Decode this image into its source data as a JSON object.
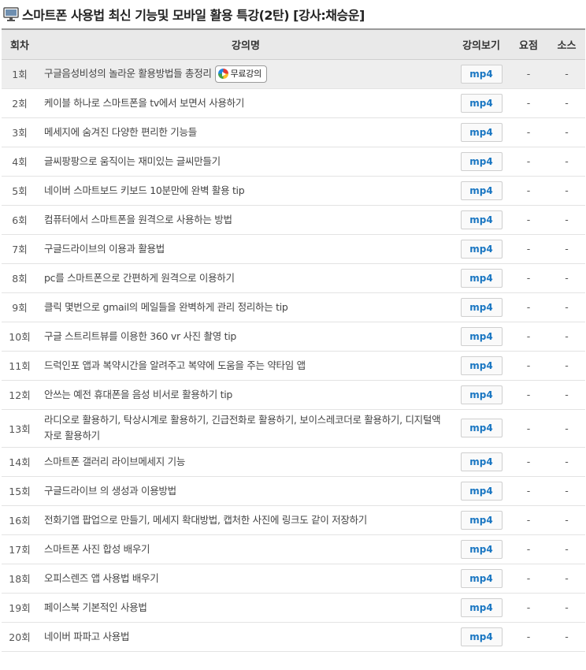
{
  "page": {
    "title": "스마트폰 사용법 최신 기능및 모바일 활용 특강(2탄) [강사:채승운]"
  },
  "table": {
    "headers": {
      "no": "회차",
      "subject": "강의명",
      "view": "강의보기",
      "summary": "요점",
      "source": "소스"
    },
    "free_badge": "무료강의",
    "rows": [
      {
        "no": "1회",
        "subject": "구글음성비성의 놀라운 활용방법들 총정리",
        "view": "mp4",
        "summary": "-",
        "source": "-"
      },
      {
        "no": "2회",
        "subject": "케이블 하나로 스마트폰을 tv에서 보면서 사용하기",
        "view": "mp4",
        "summary": "-",
        "source": "-"
      },
      {
        "no": "3회",
        "subject": "메세지에 숨겨진 다양한 편리한 기능들",
        "view": "mp4",
        "summary": "-",
        "source": "-"
      },
      {
        "no": "4회",
        "subject": "글씨팡팡으로 움직이는 재미있는 글씨만들기",
        "view": "mp4",
        "summary": "-",
        "source": "-"
      },
      {
        "no": "5회",
        "subject": "네이버 스마트보드 키보드 10분만에 완벽 활용 tip",
        "view": "mp4",
        "summary": "-",
        "source": "-"
      },
      {
        "no": "6회",
        "subject": "컴퓨터에서 스마트폰을 원격으로 사용하는 방법",
        "view": "mp4",
        "summary": "-",
        "source": "-"
      },
      {
        "no": "7회",
        "subject": "구글드라이브의 이용과 활용법",
        "view": "mp4",
        "summary": "-",
        "source": "-"
      },
      {
        "no": "8회",
        "subject": "pc를 스마트폰으로 간편하게 원격으로 이용하기",
        "view": "mp4",
        "summary": "-",
        "source": "-"
      },
      {
        "no": "9회",
        "subject": "클릭 몇번으로 gmail의 메일들을 완벽하게 관리 정리하는 tip",
        "view": "mp4",
        "summary": "-",
        "source": "-"
      },
      {
        "no": "10회",
        "subject": "구글 스트리트뷰를 이용한 360 vr 사진 촬영 tip",
        "view": "mp4",
        "summary": "-",
        "source": "-"
      },
      {
        "no": "11회",
        "subject": "드럭인포 앱과 복약시간을 알려주고 복약에 도움을 주는 약타임 앱",
        "view": "mp4",
        "summary": "-",
        "source": "-"
      },
      {
        "no": "12회",
        "subject": "안쓰는 예전 휴대폰을 음성 비서로 활용하기 tip",
        "view": "mp4",
        "summary": "-",
        "source": "-"
      },
      {
        "no": "13회",
        "subject": "라디오로 활용하기, 탁상시계로 활용하기, 긴급전화로 활용하기, 보이스레코더로 활용하기, 디지털액자로 활용하기",
        "view": "mp4",
        "summary": "-",
        "source": "-"
      },
      {
        "no": "14회",
        "subject": "스마트폰 갤러리 라이브메세지 기능",
        "view": "mp4",
        "summary": "-",
        "source": "-"
      },
      {
        "no": "15회",
        "subject": "구글드라이브 의 생성과 이용방법",
        "view": "mp4",
        "summary": "-",
        "source": "-"
      },
      {
        "no": "16회",
        "subject": "전화기앱 팝업으로 만들기, 메세지 확대방법, 캡처한 사진에 링크도 같이 저장하기",
        "view": "mp4",
        "summary": "-",
        "source": "-"
      },
      {
        "no": "17회",
        "subject": "스마트폰 사진 합성 배우기",
        "view": "mp4",
        "summary": "-",
        "source": "-"
      },
      {
        "no": "18회",
        "subject": "오피스렌즈 앱 사용법 배우기",
        "view": "mp4",
        "summary": "-",
        "source": "-"
      },
      {
        "no": "19회",
        "subject": "페이스북 기본적인 사용법",
        "view": "mp4",
        "summary": "-",
        "source": "-"
      },
      {
        "no": "20회",
        "subject": "네이버 파파고 사용법",
        "view": "mp4",
        "summary": "-",
        "source": "-"
      }
    ]
  }
}
